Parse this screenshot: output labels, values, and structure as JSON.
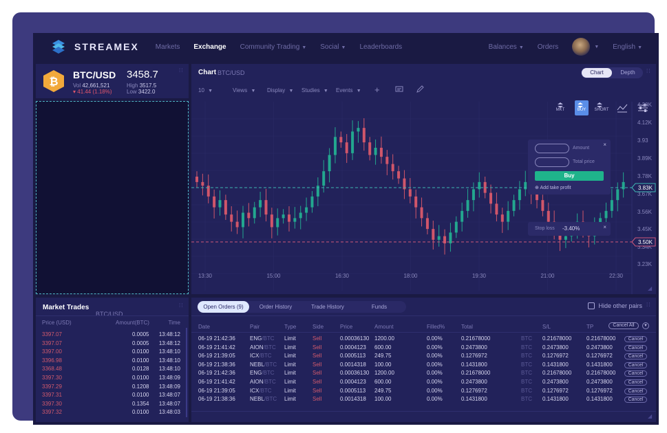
{
  "brand": {
    "name": "STREAMEX"
  },
  "nav": {
    "items": [
      {
        "label": "Markets",
        "has_caret": false
      },
      {
        "label": "Exchange",
        "has_caret": false,
        "active": true
      },
      {
        "label": "Community Trading",
        "has_caret": true
      },
      {
        "label": "Social",
        "has_caret": true
      },
      {
        "label": "Leaderboards",
        "has_caret": false
      }
    ],
    "right": {
      "balances": "Balances",
      "orders": "Orders",
      "language": "English"
    }
  },
  "ticker": {
    "pair": "BTC/USD",
    "price": "3458.7",
    "vol_label": "Vol",
    "vol": "42,661,521",
    "change": "▾ 41.44 (1.18%)",
    "high_label": "High",
    "high": "3517.5",
    "low_label": "Low",
    "low": "3422.0"
  },
  "chart_panel": {
    "title": "Chart",
    "subtitle": "BTC/USD",
    "toggle": {
      "left": "Chart",
      "right": "Depth"
    },
    "toolbar": {
      "interval": "10",
      "views": "Views",
      "display": "Display",
      "studies": "Studies",
      "events": "Events"
    },
    "side_buttons": {
      "mkt": "MKT",
      "buy": "BUY",
      "short": "SHORT"
    }
  },
  "chart_data": {
    "type": "candlestick",
    "x_ticks": [
      "13:30",
      "15:00",
      "16:30",
      "18:00",
      "19:30",
      "21:00",
      "22:30"
    ],
    "y_ticks": [
      "4.38K",
      "4.12K",
      "3.93",
      "3.89K",
      "3.78K",
      "3.67K",
      "3.56K",
      "3.45K",
      "3.34K",
      "3.23K"
    ],
    "price_markers": [
      {
        "label": "3.83K",
        "color": "#3fb7b3"
      },
      {
        "label": "3.50K",
        "color": "#d0587a"
      }
    ],
    "up_color": "#23a78f",
    "down_color": "#d0566a",
    "closes": [
      3.8,
      3.78,
      3.72,
      3.66,
      3.7,
      3.62,
      3.58,
      3.55,
      3.63,
      3.6,
      3.66,
      3.7,
      3.62,
      3.55,
      3.6,
      3.62,
      3.58,
      3.6,
      3.63,
      3.66,
      3.72,
      3.78,
      3.86,
      3.95,
      4.05,
      4.02,
      3.96,
      4.08,
      4.1,
      4.02,
      3.95,
      3.99,
      3.94,
      3.9,
      3.86,
      3.82,
      3.76,
      3.72,
      3.66,
      3.6,
      3.54,
      3.48,
      3.5,
      3.46,
      3.52,
      3.58,
      3.64,
      3.7,
      3.76,
      3.8,
      3.74,
      3.68,
      3.62,
      3.58,
      3.64,
      3.7,
      3.76,
      3.8,
      3.74,
      3.7,
      3.64,
      3.58,
      3.52,
      3.48,
      3.5,
      3.54,
      3.58,
      3.53,
      3.5,
      3.55,
      3.6,
      3.64,
      3.7,
      3.76,
      3.8
    ]
  },
  "popup": {
    "amount": "Amount",
    "total_price": "Total price",
    "buy": "Buy",
    "take_profit": "Add take profit",
    "stop_loss": "Stop loss",
    "stop_value": "-3.40%"
  },
  "market_trades": {
    "title": "Market Trades",
    "subtitle": "BTC/USD",
    "headers": {
      "price": "Price (USD)",
      "amount": "Amount(BTC)",
      "time": "Time"
    },
    "rows": [
      {
        "price": "3397.07",
        "amount": "0.0005",
        "time": "13:48:12"
      },
      {
        "price": "3397.07",
        "amount": "0.0005",
        "time": "13:48:12"
      },
      {
        "price": "3397.00",
        "amount": "0.0100",
        "time": "13:48:10"
      },
      {
        "price": "3396.98",
        "amount": "0.0100",
        "time": "13:48:10"
      },
      {
        "price": "3368.48",
        "amount": "0.0128",
        "time": "13:48:10"
      },
      {
        "price": "3397.30",
        "amount": "0.0100",
        "time": "13:48:09"
      },
      {
        "price": "3397.29",
        "amount": "0.1208",
        "time": "13:48:09"
      },
      {
        "price": "3397.31",
        "amount": "0.0100",
        "time": "13:48:07"
      },
      {
        "price": "3397.30",
        "amount": "0.1354",
        "time": "13:48:07"
      },
      {
        "price": "3397.32",
        "amount": "0.0100",
        "time": "13:48:03"
      }
    ]
  },
  "orders": {
    "tabs": [
      "Open Orders (9)",
      "Order History",
      "Trade History",
      "Funds"
    ],
    "hide_label": "Hide other pairs",
    "cancel_all": "Cancel All",
    "headers": [
      "Date",
      "Pair",
      "Type",
      "Side",
      "Price",
      "Amount",
      "Filled%",
      "Total",
      "S/L",
      "TP"
    ],
    "rows": [
      {
        "date": "06-19 21:42:36",
        "base": "ENG",
        "quote": "/BTC",
        "type": "Limit",
        "side": "Sell",
        "price": "0.00036130",
        "amount": "1200.00",
        "filled": "0.00%",
        "total": "0.21678000",
        "unit": "BTC",
        "sl": "0.21678000",
        "tp": "0.21678000",
        "cancel": "Cancel"
      },
      {
        "date": "06-19 21:41:42",
        "base": "AION",
        "quote": "/BTC",
        "type": "Limit",
        "side": "Sell",
        "price": "0.0004123",
        "amount": "600.00",
        "filled": "0.00%",
        "total": "0.2473800",
        "unit": "BTC",
        "sl": "0.2473800",
        "tp": "0.2473800",
        "cancel": "Cancel"
      },
      {
        "date": "06-19 21:39:05",
        "base": "ICX",
        "quote": "/BTC",
        "type": "Limit",
        "side": "Sell",
        "price": "0.0005113",
        "amount": "249.75",
        "filled": "0.00%",
        "total": "0.1276972",
        "unit": "BTC",
        "sl": "0.1276972",
        "tp": "0.1276972",
        "cancel": "Cancel"
      },
      {
        "date": "06-19 21:38:36",
        "base": "NEBL",
        "quote": "/BTC",
        "type": "Limit",
        "side": "Sell",
        "price": "0.0014318",
        "amount": "100.00",
        "filled": "0.00%",
        "total": "0.1431800",
        "unit": "BTC",
        "sl": "0.1431800",
        "tp": "0.1431800",
        "cancel": "Cancel"
      },
      {
        "date": "06-19 21:42:36",
        "base": "ENG",
        "quote": "/BTC",
        "type": "Limit",
        "side": "Sell",
        "price": "0.00036130",
        "amount": "1200.00",
        "filled": "0.00%",
        "total": "0.21678000",
        "unit": "BTC",
        "sl": "0.21678000",
        "tp": "0.21678000",
        "cancel": "Cancel"
      },
      {
        "date": "06-19 21:41:42",
        "base": "AION",
        "quote": "/BTC",
        "type": "Limit",
        "side": "Sell",
        "price": "0.0004123",
        "amount": "600.00",
        "filled": "0.00%",
        "total": "0.2473800",
        "unit": "BTC",
        "sl": "0.2473800",
        "tp": "0.2473800",
        "cancel": "Cancel"
      },
      {
        "date": "06-19 21:39:05",
        "base": "ICX",
        "quote": "/BTC",
        "type": "Limit",
        "side": "Sell",
        "price": "0.0005113",
        "amount": "249.75",
        "filled": "0.00%",
        "total": "0.1276972",
        "unit": "BTC",
        "sl": "0.1276972",
        "tp": "0.1276972",
        "cancel": "Cancel"
      },
      {
        "date": "06-19 21:38:36",
        "base": "NEBL",
        "quote": "/BTC",
        "type": "Limit",
        "side": "Sell",
        "price": "0.0014318",
        "amount": "100.00",
        "filled": "0.00%",
        "total": "0.1431800",
        "unit": "BTC",
        "sl": "0.1431800",
        "tp": "0.1431800",
        "cancel": "Cancel"
      }
    ]
  }
}
